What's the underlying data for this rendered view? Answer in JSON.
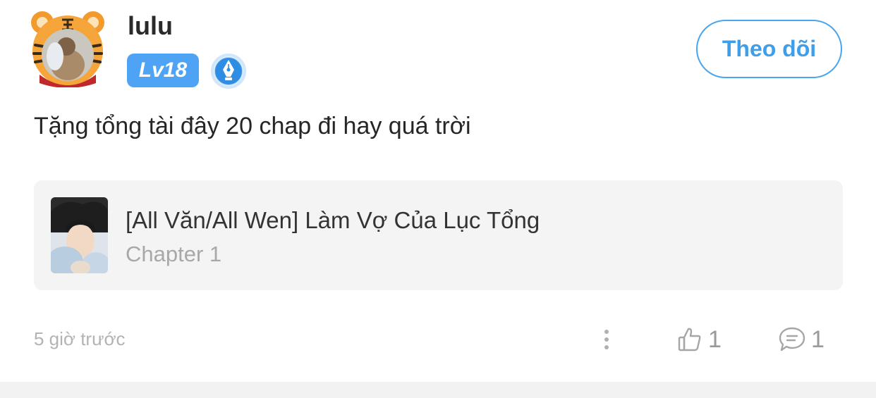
{
  "user": {
    "name": "lulu",
    "level": "Lv18",
    "avatar_icon": "tiger-hood-avatar",
    "badge_icon": "pen-nib-icon"
  },
  "follow_button": {
    "label": "Theo dõi"
  },
  "post": {
    "text": "Tặng tổng tài đây 20 chap đi hay quá trời"
  },
  "referenced_story": {
    "title": "[All Văn/All Wen] Làm Vợ Của Lục Tổng",
    "chapter": "Chapter 1"
  },
  "footer": {
    "timestamp": "5 giờ trước",
    "likes": "1",
    "comments": "1"
  },
  "colors": {
    "accent": "#4ea3f5",
    "follow_text": "#3f9eea",
    "card_bg": "#f4f4f4",
    "muted": "#a8a8a8"
  }
}
